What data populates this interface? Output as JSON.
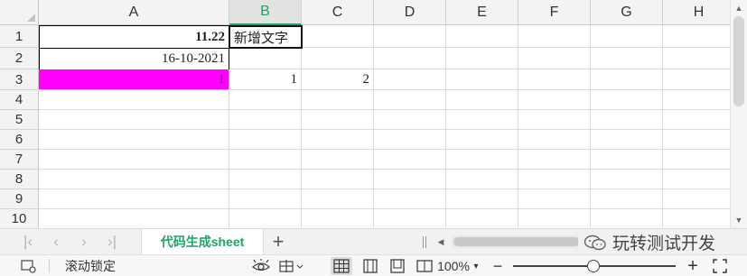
{
  "columns": [
    "A",
    "B",
    "C",
    "D",
    "E",
    "F",
    "G",
    "H"
  ],
  "selected_column": "B",
  "rows": [
    "1",
    "2",
    "3",
    "4",
    "5",
    "6",
    "7",
    "8",
    "9",
    "10"
  ],
  "cells": {
    "A1": "11.22",
    "B1": "新增文字",
    "A2": "16-10-2021",
    "A3": "1",
    "B3": "1",
    "C3": "2"
  },
  "colors": {
    "accent": "#21a366",
    "highlight_fill": "#ff00ff"
  },
  "sheet_tabs": [
    {
      "label": "代码生成sheet",
      "active": true
    }
  ],
  "tab_nav_icons": [
    "first-sheet-icon",
    "prev-sheet-icon",
    "next-sheet-icon",
    "last-sheet-icon"
  ],
  "add_sheet_glyph": "+",
  "watermark_text": "玩转测试开发",
  "status": {
    "scroll_lock_label": "滚动锁定",
    "zoom_label": "100%",
    "zoom_minus": "−",
    "zoom_plus": "+"
  }
}
